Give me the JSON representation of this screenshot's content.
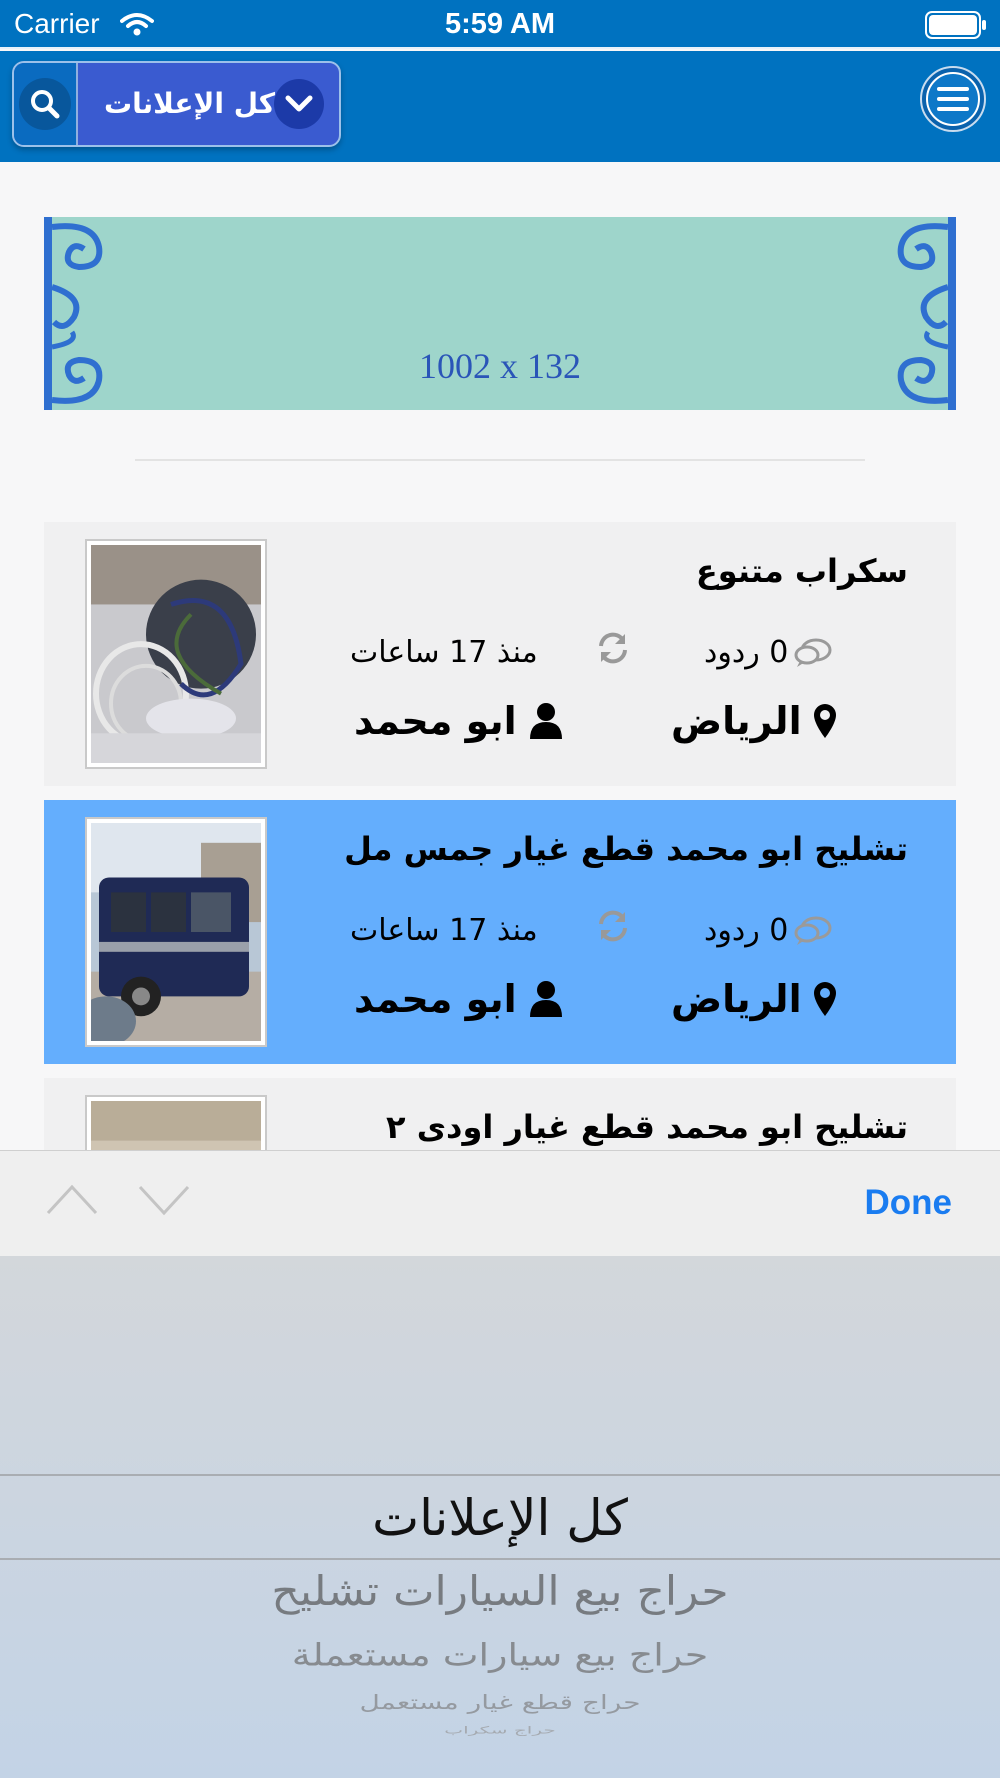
{
  "status_bar": {
    "carrier": "Carrier",
    "time": "5:59 AM"
  },
  "header": {
    "filter_label": "كل الإعلانات"
  },
  "banner": {
    "text": "1002 x 132"
  },
  "listings": [
    {
      "title": "سكراب متنوع",
      "replies": "0 ردود",
      "time_ago": "منذ 17 ساعات",
      "location": "الرياض",
      "author": "ابو محمد"
    },
    {
      "title": "تشليح ابو محمد قطع غيار جمس مل",
      "replies": "0 ردود",
      "time_ago": "منذ 17 ساعات",
      "location": "الرياض",
      "author": "ابو محمد"
    },
    {
      "title": "تشليح ابو محمد قطع غيار اودى ٢"
    }
  ],
  "picker_toolbar": {
    "done_label": "Done"
  },
  "picker": {
    "options": [
      "كل الإعلانات",
      "حراج بيع السيارات تشليح",
      "حراج بيع سيارات مستعملة",
      "حراج قطع غيار مستعمل",
      "حراج سكراب"
    ],
    "selected": "كل الإعلانات"
  },
  "colors": {
    "primary": "#0072c0",
    "selected_row": "#64aefd",
    "done": "#1a7cf0"
  }
}
